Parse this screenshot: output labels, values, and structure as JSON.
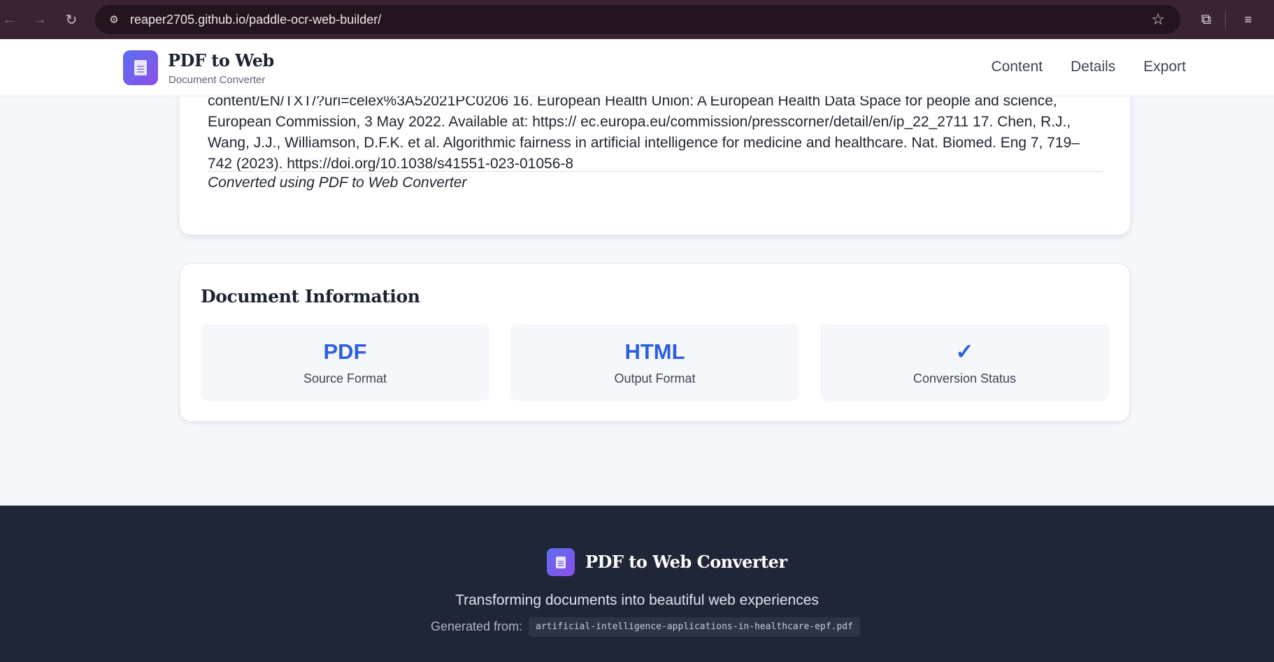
{
  "browser": {
    "url": "reaper2705.github.io/paddle-ocr-web-builder/",
    "icons": [
      "back-arrow-icon",
      "forward-arrow-icon",
      "reload-icon",
      "site-info-icon",
      "bookmark-star-icon",
      "extensions-icon",
      "media-controls-icon"
    ]
  },
  "header": {
    "brand_title": "PDF to Web",
    "brand_subtitle": "Document Converter",
    "nav": [
      "Content",
      "Details",
      "Export"
    ]
  },
  "content": {
    "reference_text": "content/EN/TXT/?uri=celex%3A52021PC0206 16. European Health Union: A European Health Data Space for people and science, European Commission, 3 May 2022. Available at: https:// ec.europa.eu/commission/presscorner/detail/en/ip_22_2711 17. Chen, R.J., Wang, J.J., Williamson, D.F.K. et al. Algorithmic fairness in artificial intelligence for medicine and healthcare. Nat. Biomed. Eng 7, 719–742 (2023). https://doi.org/10.1038/s41551-023-01056-8",
    "converted_note": "Converted using PDF to Web Converter"
  },
  "info": {
    "title": "Document Information",
    "tiles": [
      {
        "value": "PDF",
        "label": "Source Format"
      },
      {
        "value": "HTML",
        "label": "Output Format"
      },
      {
        "value": "✓",
        "label": "Conversion Status"
      }
    ]
  },
  "footer": {
    "title": "PDF to Web Converter",
    "tagline": "Transforming documents into beautiful web experiences",
    "generated_label": "Generated from:",
    "filename": "artificial-intelligence-applications-in-healthcare-epf.pdf"
  },
  "colors": {
    "accent": "#2b5fe0",
    "logo_gradient_start": "#5b6ff0",
    "logo_gradient_end": "#8b4fe8",
    "footer_bg": "#1f2638",
    "chrome_bg": "#3a2434"
  }
}
